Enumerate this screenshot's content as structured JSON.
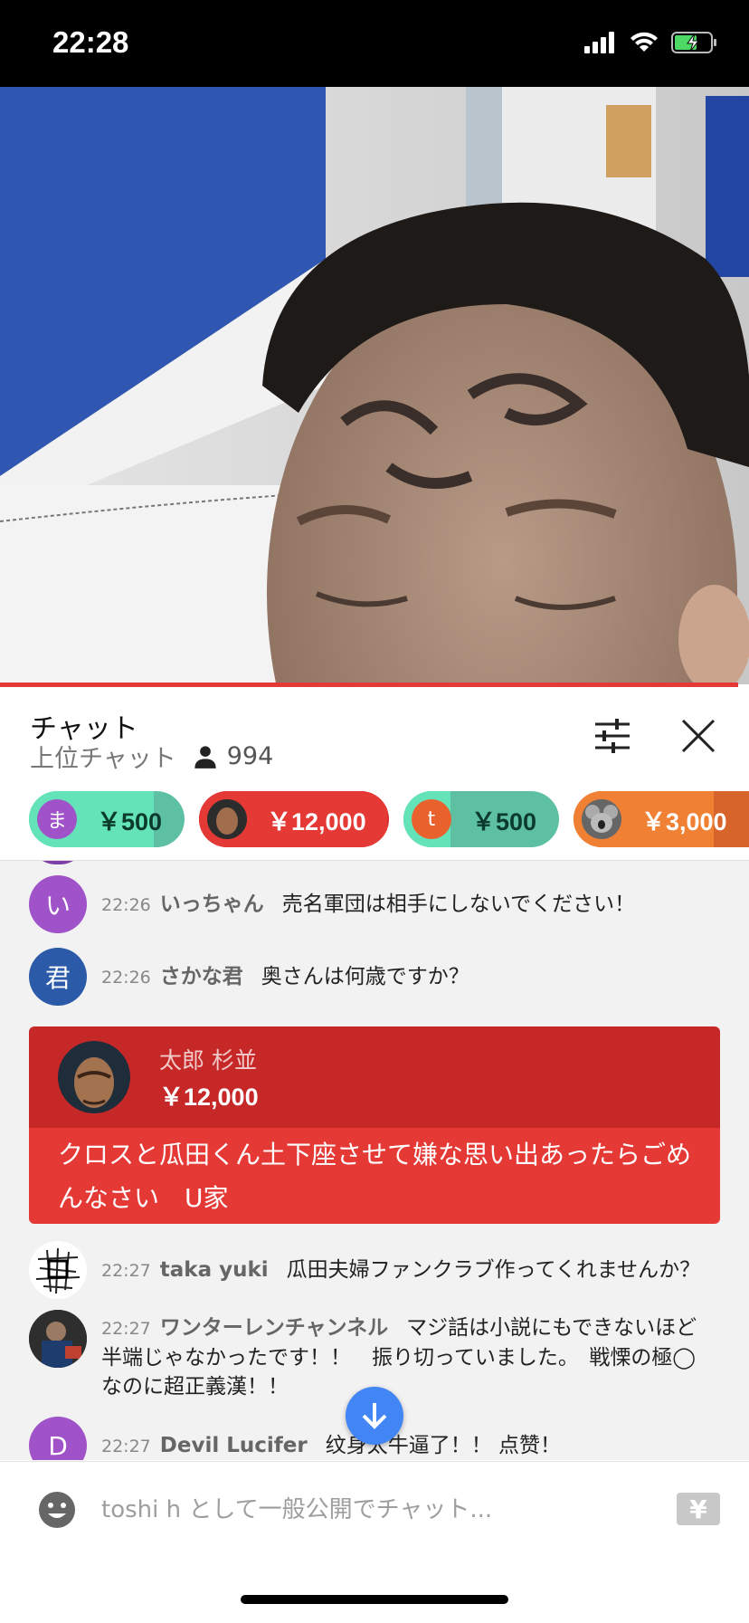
{
  "status": {
    "time": "22:28"
  },
  "chat": {
    "title": "チャット",
    "mode": "上位チャット",
    "viewer_count": "994"
  },
  "tickers": [
    {
      "avatar_text": "ま",
      "amount": "￥500",
      "bg": "#5ec0a3",
      "fill_color": "#64e3b9",
      "progress": 0.8,
      "avatar_color": "#a052c8"
    },
    {
      "avatar_text": "",
      "amount": "￥12,000",
      "bg": "#d32f2f",
      "fill_color": "#e53935",
      "progress": 0.99,
      "avatar_color": "#5a4230"
    },
    {
      "avatar_text": "t",
      "amount": "￥500",
      "bg": "#5ec0a3",
      "fill_color": "#64e3b9",
      "progress": 0.3,
      "avatar_color": "#e9622e"
    },
    {
      "avatar_text": "",
      "amount": "￥3,000",
      "bg": "#d7642a",
      "fill_color": "#f08034",
      "progress": 0.8,
      "avatar_color": "#777"
    }
  ],
  "messages": [
    {
      "avatar_text": "い",
      "avatar_color": "#a052c8",
      "time": "22:26",
      "author": "いっちゃん",
      "text": "売名軍団は相手にしないでください！"
    },
    {
      "avatar_text": "君",
      "avatar_color": "#2b5aa8",
      "time": "22:26",
      "author": "さかな君",
      "text": "奥さんは何歳ですか？"
    },
    {
      "avatar_text": "",
      "avatar_color": "#fff",
      "time": "22:27",
      "author": "taka yuki",
      "text": "瓜田夫婦ファンクラブ作ってくれませんか？"
    },
    {
      "avatar_text": "",
      "avatar_color": "#3b3b3b",
      "time": "22:27",
      "author": "ワンターレンチャンネル",
      "text": "マジ話は小説にもできないほど半端じゃなかったです！！　振り切っていました。　戦慄の極◯なのに超正義漢！！"
    },
    {
      "avatar_text": "D",
      "avatar_color": "#a052c8",
      "time": "22:27",
      "author": "Devil Lucifer",
      "text": "纹身太牛逼了！！ 点赞！"
    }
  ],
  "superchat": {
    "name": "太郎 杉並",
    "amount": "￥12,000",
    "message": "クロスと瓜田くん土下座させて嫌な思い出あったらごめんなさい　U家"
  },
  "input": {
    "placeholder": "toshi h として一般公開でチャット..."
  },
  "icons": {
    "signal": "signal-icon",
    "wifi": "wifi-icon",
    "battery": "battery-charging-icon",
    "settings": "filter-sliders-icon",
    "close": "close-icon",
    "viewers": "person-icon",
    "scroll": "arrow-down-icon",
    "emoji": "emoji-icon",
    "yen": "yen-icon"
  },
  "yen_label": "¥"
}
